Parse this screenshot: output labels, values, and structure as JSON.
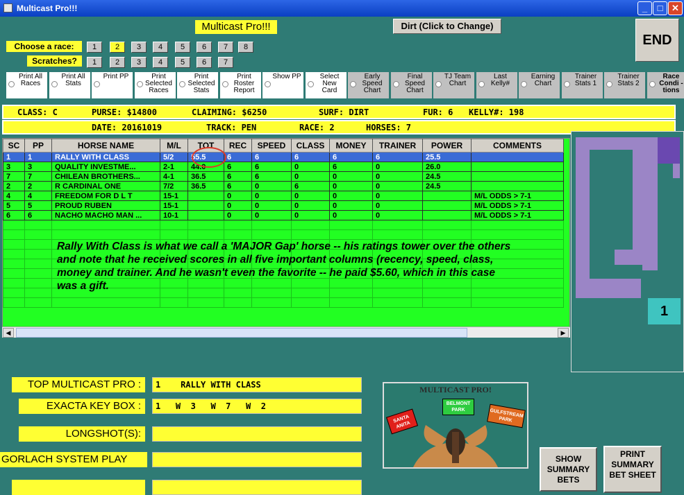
{
  "window": {
    "title": "Multicast Pro!!!"
  },
  "header": {
    "app_label": "Multicast Pro!!!",
    "dirt_button": "Dirt (Click to Change)",
    "end_button": "END"
  },
  "race_select": {
    "label": "Choose  a race:",
    "options": [
      "1",
      "2",
      "3",
      "4",
      "5",
      "6",
      "7",
      "8"
    ],
    "selected": "2"
  },
  "scratches": {
    "label": "Scratches?",
    "options": [
      "1",
      "2",
      "3",
      "4",
      "5",
      "6",
      "7"
    ]
  },
  "options": [
    {
      "label": "Print All Races"
    },
    {
      "label": "Print All Stats"
    },
    {
      "label": "Print PP"
    },
    {
      "label": "Print Selected Races"
    },
    {
      "label": "Print Selected Stats"
    },
    {
      "label": "Print Roster Report"
    },
    {
      "label": "Show PP"
    },
    {
      "label": "Select New Card"
    },
    {
      "label": "Early Speed Chart"
    },
    {
      "label": "Final Speed Chart"
    },
    {
      "label": "TJ Team Chart"
    },
    {
      "label": "Last Kelly#"
    },
    {
      "label": "Earning Chart"
    },
    {
      "label": "Trainer Stats 1"
    },
    {
      "label": "Trainer Stats 2"
    },
    {
      "label": "Race Condi -tions"
    }
  ],
  "info1": {
    "class": "CLASS: C",
    "purse": "PURSE: $14800",
    "claiming": "CLAIMING: $6250",
    "surf": "SURF: DIRT",
    "fur": "FUR: 6",
    "kelly": "KELLY#: 198"
  },
  "info2": {
    "date": "DATE: 20161019",
    "track": "TRACK: PEN",
    "race": "RACE: 2",
    "horses": "HORSES: 7"
  },
  "grid": {
    "headers": [
      "SC",
      "PP",
      "HORSE NAME",
      "M/L",
      "TOT",
      "REC",
      "SPEED",
      "CLASS",
      "MONEY",
      "TRAINER",
      "POWER",
      "COMMENTS"
    ],
    "rows": [
      [
        "1",
        "1",
        "RALLY WITH CLASS",
        "5/2",
        "55.5",
        "6",
        "6",
        "6",
        "6",
        "6",
        "25.5",
        ""
      ],
      [
        "3",
        "3",
        "QUALITY INVESTME...",
        "2-1",
        "44.0",
        "6",
        "6",
        "0",
        "6",
        "0",
        "26.0",
        ""
      ],
      [
        "7",
        "7",
        "CHILEAN BROTHERS...",
        "4-1",
        "36.5",
        "6",
        "6",
        "0",
        "0",
        "0",
        "24.5",
        ""
      ],
      [
        "2",
        "2",
        "R CARDINAL ONE",
        "7/2",
        "36.5",
        "6",
        "0",
        "6",
        "0",
        "0",
        "24.5",
        ""
      ],
      [
        "4",
        "4",
        "FREEDOM FOR D L T",
        "15-1",
        "",
        "0",
        "0",
        "0",
        "0",
        "0",
        "",
        "M/L ODDS > 7-1"
      ],
      [
        "5",
        "5",
        "PROUD RUBEN",
        "15-1",
        "",
        "0",
        "0",
        "0",
        "0",
        "0",
        "",
        "M/L ODDS > 7-1"
      ],
      [
        "6",
        "6",
        "NACHO MACHO MAN ...",
        "10-1",
        "",
        "0",
        "0",
        "0",
        "0",
        "0",
        "",
        "M/L ODDS > 7-1"
      ]
    ]
  },
  "annotation": "Rally With Class is what we call a 'MAJOR Gap' horse -- his ratings tower over the others and note that he received scores in all five important columns (recency, speed, class, money and trainer.  And he wasn't even the favorite -- he paid $5.60, which in this case was a gift.",
  "side_panel": {
    "race_number": "1"
  },
  "bottom": {
    "top_multicast_label": "TOP MULTICAST PRO :",
    "top_multicast_value": "1    RALLY WITH CLASS",
    "exacta_label": "EXACTA KEY BOX :",
    "exacta_value": "1   W  3   W  7   W  2",
    "longshot_label": "LONGSHOT(S):",
    "longshot_value": "",
    "gorlach_label": "GORLACH SYSTEM PLAY",
    "gorlach_value": ""
  },
  "logo": {
    "title": "MULTICAST PRO!",
    "belmont": "BELMONT PARK",
    "santa": "SANTA ANITA",
    "gulf": "GULFSTREAM PARK"
  },
  "buttons": {
    "show_summary": "SHOW SUMMARY BETS",
    "print_summary": "PRINT SUMMARY BET SHEET"
  }
}
